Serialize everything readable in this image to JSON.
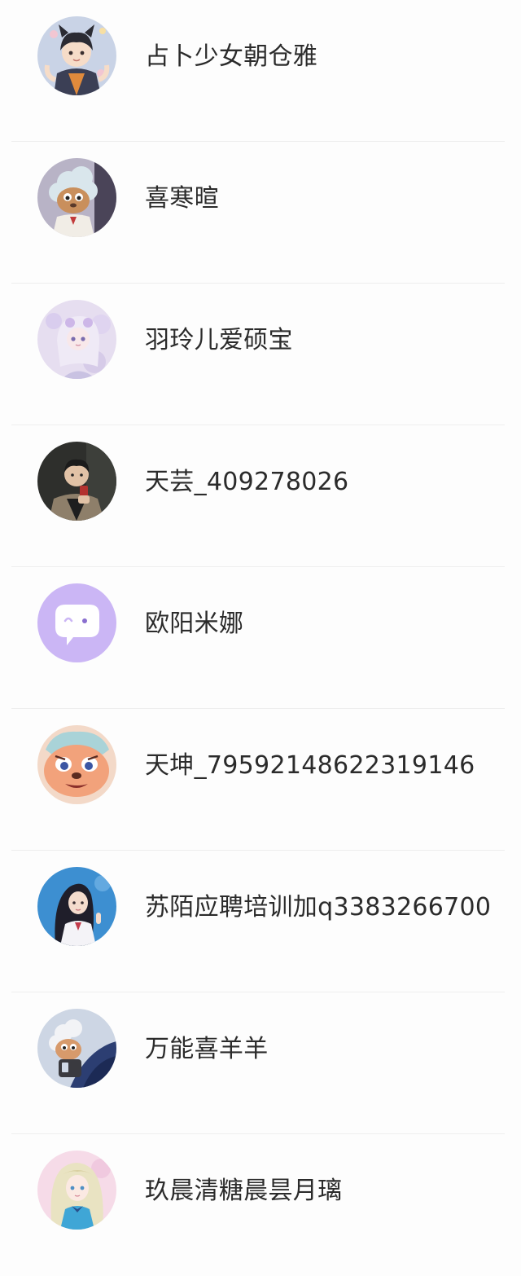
{
  "users": [
    {
      "name": "占卜少女朝仓雅",
      "avatar_icon": "anime-boy-cat-ears-avatar-icon"
    },
    {
      "name": "喜寒暄",
      "avatar_icon": "cartoon-sheep-avatar-icon"
    },
    {
      "name": "羽玲儿爱硕宝",
      "avatar_icon": "anime-girl-pastel-avatar-icon"
    },
    {
      "name": "天芸_409278026",
      "avatar_icon": "man-photo-avatar-icon"
    },
    {
      "name": "欧阳米娜",
      "avatar_icon": "default-chat-bubble-avatar-icon"
    },
    {
      "name": "天坤_79592148622319146",
      "avatar_icon": "cartoon-wolf-avatar-icon"
    },
    {
      "name": "苏陌应聘培训加q3383266700",
      "avatar_icon": "anime-girl-blue-background-avatar-icon"
    },
    {
      "name": "万能喜羊羊",
      "avatar_icon": "cartoon-sheep-car-avatar-icon"
    },
    {
      "name": "玖晨清糖晨昙月璃",
      "avatar_icon": "anime-girl-blonde-avatar-icon"
    }
  ],
  "colors": {
    "text": "#2b2b2b",
    "divider": "#eeeeee",
    "background": "#fdfdfd",
    "default_avatar_bg": "#cbb6f5"
  }
}
